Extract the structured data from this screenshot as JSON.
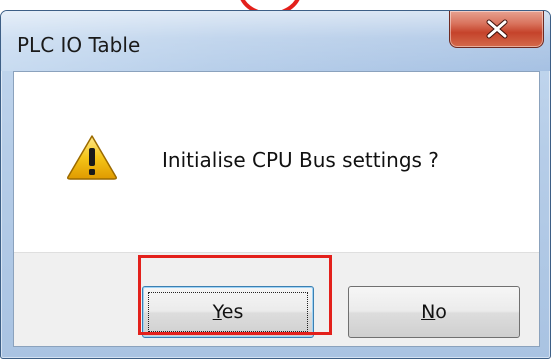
{
  "window": {
    "title": "PLC IO Table",
    "close_icon": "close-icon"
  },
  "message": {
    "icon": "warning-icon",
    "text": "Initialise CPU Bus settings ?"
  },
  "buttons": {
    "yes_label": "Yes",
    "no_label": "No"
  },
  "colors": {
    "annotation": "#e3201b",
    "close_button": "#c5432b",
    "warning_yellow": "#f5c518"
  }
}
